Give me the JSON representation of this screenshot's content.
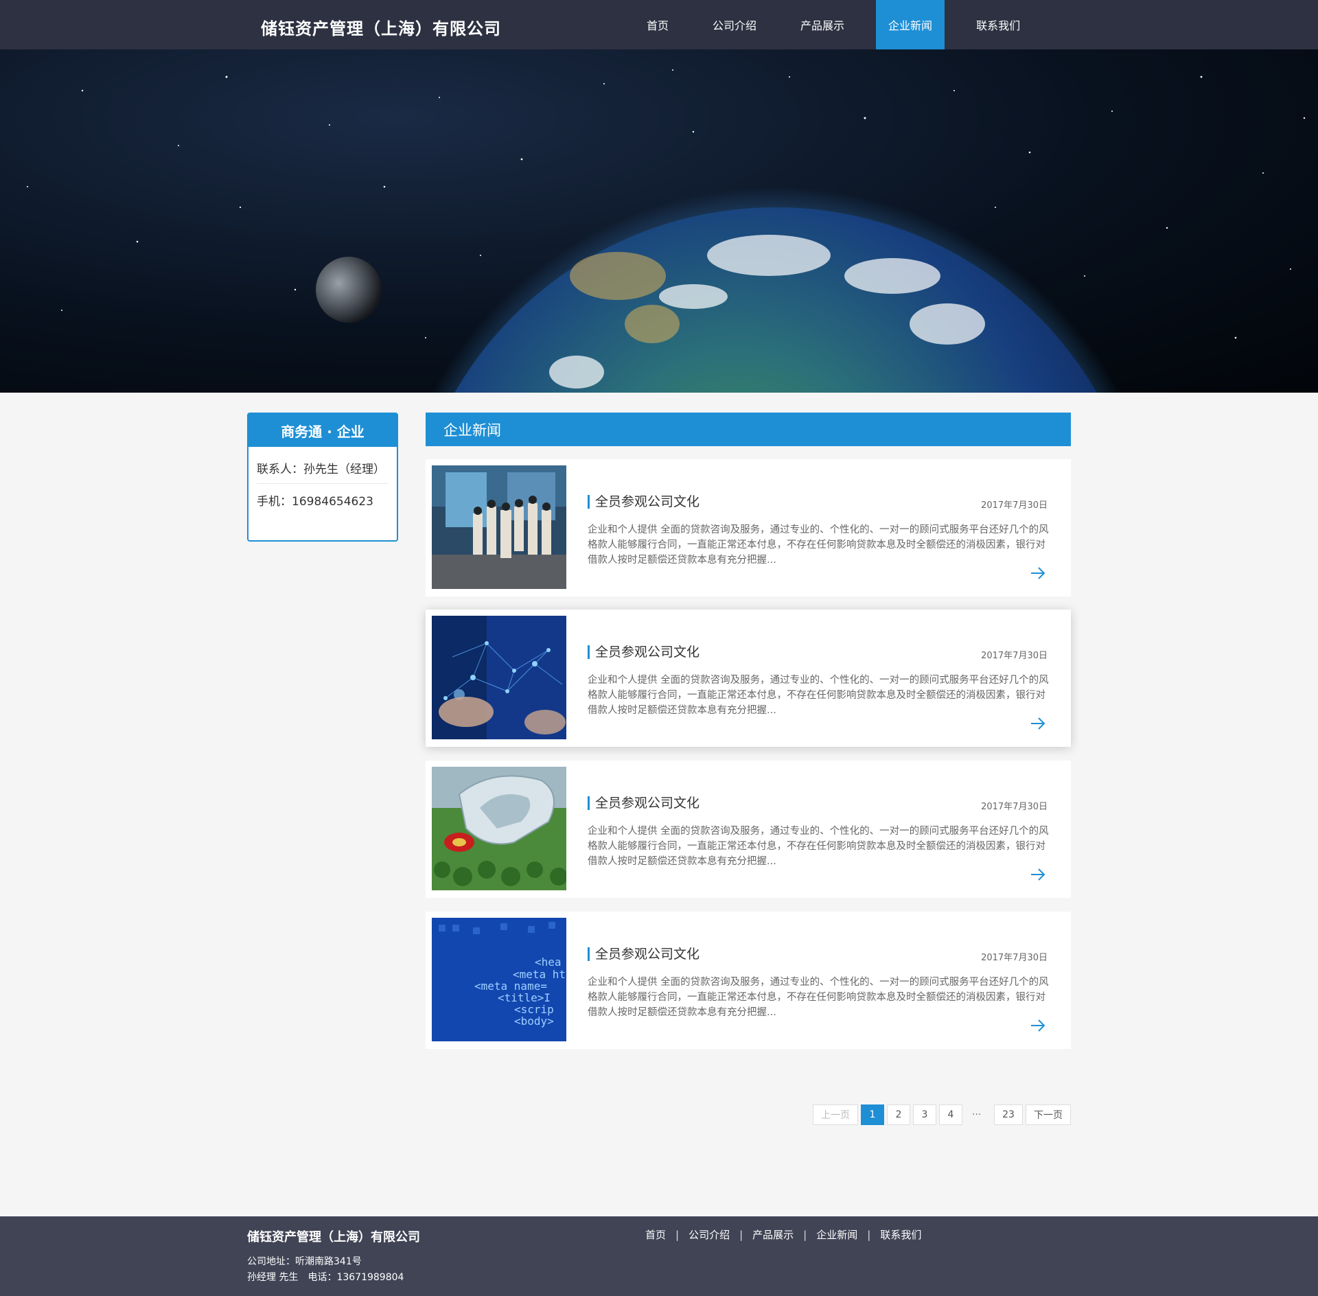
{
  "header": {
    "brand": "储钰资产管理（上海）有限公司",
    "nav": [
      "首页",
      "公司介绍",
      "产品展示",
      "企业新闻",
      "联系我们"
    ],
    "active_nav": "企业新闻"
  },
  "sidebar": {
    "title": "商务通 · 企业",
    "contact_line": "联系人：孙先生（经理）",
    "phone_line": "手机：16984654623"
  },
  "main": {
    "section_title": "企业新闻",
    "news": [
      {
        "title": "全员参观公司文化",
        "date": "2017年7月30日",
        "summary": "企业和个人提供 全面的贷款咨询及服务，通过专业的、个性化的、一对一的顾问式服务平台还好几个的风格款人能够履行合同，一直能正常还本付息，不存在任何影响贷款本息及时全额偿还的消极因素，银行对借款人按时足额偿还贷款本息有充分把握...",
        "image": "exhibition-visit-photo"
      },
      {
        "title": "全员参观公司文化",
        "date": "2017年7月30日",
        "summary": "企业和个人提供 全面的贷款咨询及服务，通过专业的、个性化的、一对一的顾问式服务平台还好几个的风格款人能够履行合同，一直能正常还本付息，不存在任何影响贷款本息及时全额偿还的消极因素，银行对借款人按时足额偿还贷款本息有充分把握...",
        "image": "tech-network-hand-photo"
      },
      {
        "title": "全员参观公司文化",
        "date": "2017年7月30日",
        "summary": "企业和个人提供 全面的贷款咨询及服务，通过专业的、个性化的、一对一的顾问式服务平台还好几个的风格款人能够履行合同，一直能正常还本付息，不存在任何影响贷款本息及时全额偿还的消极因素，银行对借款人按时足额偿还贷款本息有充分把握...",
        "image": "architecture-rendering-photo"
      },
      {
        "title": "全员参观公司文化",
        "date": "2017年7月30日",
        "summary": "企业和个人提供 全面的贷款咨询及服务，通过专业的、个性化的、一对一的顾问式服务平台还好几个的风格款人能够履行合同，一直能正常还本付息，不存在任何影响贷款本息及时全额偿还的消极因素，银行对借款人按时足额偿还贷款本息有充分把握...",
        "image": "html-code-photo"
      }
    ]
  },
  "banner": {
    "image": "earth-from-space-with-moon",
    "code_lines": [
      "<hea",
      "<meta ht",
      "<meta name=",
      "<title>I",
      "<scrip",
      "<body>"
    ]
  },
  "pagination": {
    "prev": "上一页",
    "pages": [
      "1",
      "2",
      "3",
      "4"
    ],
    "ellipsis": "···",
    "last": "23",
    "next": "下一页",
    "current": "1"
  },
  "footer": {
    "brand": "储钰资产管理（上海）有限公司",
    "address": "公司地址：听潮南路341号",
    "contact": "孙经理 先生　电话：13671989804",
    "nav": [
      "首页",
      "公司介绍",
      "产品展示",
      "企业新闻",
      "联系我们"
    ],
    "separator": "|"
  },
  "colors": {
    "header_bg": "#2d3141",
    "accent": "#1e8fd5",
    "footer_bg": "#414455",
    "page_bg": "#f5f5f5"
  }
}
